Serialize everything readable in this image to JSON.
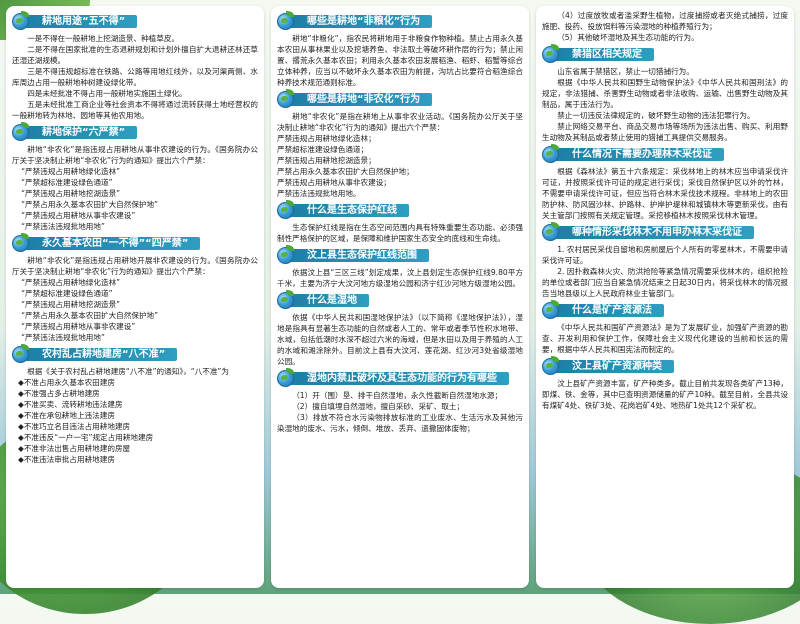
{
  "col1": {
    "s1": {
      "title": "耕地用途“五不得”",
      "paras": [
        "一是不得在一般耕地上挖湖造景、种植草皮。",
        "二是不得在国家批准的生态退耕规划和计划外擅自扩大退耕还林还草还湿还湖规模。",
        "三是不得违规超标准在铁路、公路等用地红线外，以及河渠两侧、水库周边占用一般耕地种树建设绿化带。",
        "四是未经批准不得占用一般耕地实施国土绿化。",
        "五是未经批准工商企业等社会资本不得将通过流转获得土地经营权的一般耕地转为林地、园地等其他农用地。"
      ]
    },
    "s2": {
      "title": "耕地保护“六严禁”",
      "intro": "耕地“非农化”是指违规占用耕地从事非农建设的行为。《国务院办公厅关于坚决制止耕地“非农化”行为的通知》提出六个严禁：",
      "items": [
        "“严禁违规占用耕地绿化造林”",
        "“严禁超标准建设绿色通道”",
        "“严禁违规占用耕地挖湖造景”",
        "“严禁占用永久基本农田扩大自然保护地”",
        "“严禁违规占用耕地从事非农建设”",
        "“严禁违法违规批地用地”"
      ]
    },
    "s3": {
      "title": "永久基本农田“一不得”“四严禁”",
      "intro": "耕地“非农化”是指违规占用耕地开展非农建设的行为。《国务院办公厅关于坚决制止耕地“非农化”行为的通知》提出六个严禁：",
      "items": [
        "“严禁违规占用耕地绿化造林”",
        "“严禁超标准建设绿色通道”",
        "“严禁违规占用耕地挖湖造景”",
        "“严禁占用永久基本农田扩大自然保护地”",
        "“严禁违规占用耕地从事非农建设”",
        "“严禁违法违规批地用地”"
      ]
    },
    "s4": {
      "title": "农村乱占耕地建房“八不准”",
      "intro": "根据《关于农村乱占耕地建房“八不准”的通知》，“八不准”为",
      "items": [
        "◆不准占用永久基本农田建房",
        "◆不准强占多占耕地建房",
        "◆不准买卖、流转耕地违法建房",
        "◆不准在承包耕地上违法建房",
        "◆不准巧立名目违法占用耕地建房",
        "◆不准违反“一户一宅”规定占用耕地建房",
        "◆不准非法出售占用耕地建的房屋",
        "◆不准违法审批占用耕地建房"
      ]
    }
  },
  "col2": {
    "s1": {
      "title": "哪些是耕地“非粮化”行为",
      "paras": [
        "耕地“非粮化”，指农民将耕地用于非粮食作物种植。禁止占用永久基本农田从事林果业以及挖塘养鱼、非法取土等破坏耕作层的行为；禁止闲置、撂荒永久基本农田；利用永久基本农田发展稻渔、稻虾、稻蟹等综合立体种养，应当以不破坏永久基本农田为前提，沟坑占比要符合稻渔综合种养技术规范通则标准。"
      ]
    },
    "s2": {
      "title": "哪些是耕地“非农化”行为",
      "intro": "耕地“非农化”是指在耕地上从事非农业活动。《国务院办公厅关于坚决制止耕地“非农化”行为的通知》提出六个严禁：",
      "items": [
        "严禁违规占用耕地绿化造林；",
        "严禁超标准建设绿色通道；",
        "严禁违规占用耕地挖湖造景；",
        "严禁占用永久基本农田扩大自然保护地；",
        "严禁违规占用耕地从事非农建设；",
        "严禁违法违规批地用地。"
      ]
    },
    "s3": {
      "title": "什么是生态保护红线",
      "paras": [
        "生态保护红线是指在生态空间范围内具有特殊重要生态功能、必须强制性严格保护的区域，是保障和维护国家生态安全的底线和生命线。"
      ]
    },
    "s4": {
      "title": "汶上县生态保护红线范围",
      "paras": [
        "依据汶上县“三区三线”划定成果，汶上县划定生态保护红线9.80平方千米，主要为济宁大汶河地方级湿地公园和济宁红沙河地方级湿地公园。"
      ]
    },
    "s5": {
      "title": "什么是湿地",
      "paras": [
        "依据《中华人民共和国湿地保护法》（以下简称《湿地保护法》），湿地是指具有显著生态功能的自然或者人工的、常年或者季节性积水地带、水域，包括低潮时水深不超过六米的海域，但是水田以及用于养殖的人工的水域和滩涂除外。目前汶上县有大汶河、莲花湖、红沙河3处省级湿地公园。"
      ]
    },
    "s6": {
      "title": "湿地内禁止破坏及其生态功能的行为有哪些",
      "items": [
        "（1）开（围）垦、排干自然湿地，永久性截断自然湿地水源；",
        "（2）擅自填埋自然湿地，擅自采砂、采矿、取土；",
        "（3）排放不符合水污染物排放标准的工业废水、生活污水及其他污染湿地的废水、污水，倾倒、堆放、丢弃、遗撒固体废物；"
      ]
    }
  },
  "col3": {
    "s0": {
      "items": [
        "（4）过度放牧或者滥采野生植物，过度捕捞或者灭绝式捕捞，过度施肥、投药、投放饵料等污染湿地的种植养殖行为；",
        "（5）其他破坏湿地及其生态功能的行为。"
      ]
    },
    "s1": {
      "title": "禁猎区相关规定",
      "paras": [
        "山东省属于禁猎区，禁止一切猎捕行为。",
        "根据《中华人民共和国野生动物保护法》《中华人民共和国刑法》的规定，非法猎捕、杀害野生动物或者非法收购、运输、出售野生动物及其制品，属于违法行为。",
        "禁止一切违反法律规定的，破坏野生动物的违法犯罪行为。",
        "禁止网络交易平台、商品交易市场等场所为违法出售、购买、利用野生动物及其制品或者禁止使用的猎捕工具提供交易服务。"
      ]
    },
    "s2": {
      "title": "什么情况下需要办理林木采伐证",
      "paras": [
        "根据《森林法》第五十六条规定：采伐林地上的林木应当申请采伐许可证，并按照采伐许可证的规定进行采伐；采伐自然保护区以外的竹林，不需要申请采伐许可证，但应当符合林木采伐技术规程。非林地上的农田防护林、防风固沙林、护路林、护岸护堤林和城镇林木等更新采伐，由有关主管部门按照有关规定管理。采挖移植林木按照采伐林木管理。"
      ]
    },
    "s3": {
      "title": "哪种情形采伐林木不用申办林木采伐证",
      "paras": [
        "1. 农村居民采伐自留地和房前屋后个人所有的零星林木，不需要申请采伐许可证。",
        "2. 因扑救森林火灾、防洪抢险等紧急情况需要采伐林木的，组织抢险的单位或者部门应当自紧急情况结束之日起30日内，将采伐林木的情况报告当地县级以上人民政府林业主管部门。"
      ]
    },
    "s4": {
      "title": "什么是矿产资源法",
      "paras": [
        "《中华人民共和国矿产资源法》是为了发展矿业，加强矿产资源的勘查、开发利用和保护工作，保障社会主义现代化建设的当前和长远的需要，根据中华人民共和国宪法而制定的。"
      ]
    },
    "s5": {
      "title": "汶上县矿产资源种类",
      "paras": [
        "汶上县矿产资源丰富，矿产种类多。截止目前共发现各类矿产13种，即煤、铁、金等，其中已查明资源储量的矿产10种。截至目前，全县共设有煤矿4处、铁矿3处、花岗岩矿4处、地热矿1处共12个采矿权。"
      ]
    }
  }
}
